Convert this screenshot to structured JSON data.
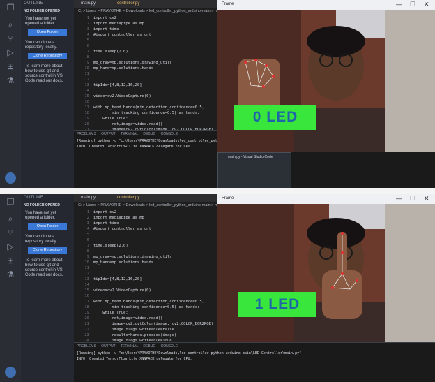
{
  "panels": [
    {
      "sidebar": {
        "header": "OUTLINE",
        "subheader": "NO FOLDER OPENED",
        "msg1": "You have not yet opened a folder.",
        "open_folder": "Open Folder",
        "msg2": "You can clone a repository locally.",
        "clone_repo": "Clone Repository",
        "msg3": "To learn more about how to use git and source control in VS Code read our docs."
      },
      "tabs": [
        "main.py",
        "controller.py"
      ],
      "breadcrumb": "C: > Users > PRAVOTHE > Downloads > led_controller_python_arduino-main > main.py",
      "code": [
        {
          "n": "1",
          "t": "import cv2"
        },
        {
          "n": "2",
          "t": "import mediapipe as mp"
        },
        {
          "n": "3",
          "t": "import time"
        },
        {
          "n": "4",
          "t": "#import controller as cnt"
        },
        {
          "n": "5",
          "t": ""
        },
        {
          "n": "6",
          "t": ""
        },
        {
          "n": "7",
          "t": "time.sleep(2.0)"
        },
        {
          "n": "8",
          "t": ""
        },
        {
          "n": "9",
          "t": "mp_draw=mp.solutions.drawing_utils"
        },
        {
          "n": "10",
          "t": "mp_hand=mp.solutions.hands"
        },
        {
          "n": "11",
          "t": ""
        },
        {
          "n": "12",
          "t": ""
        },
        {
          "n": "13",
          "t": "tipIds=[4,8,12,16,20]"
        },
        {
          "n": "14",
          "t": ""
        },
        {
          "n": "15",
          "t": "video=cv2.VideoCapture(0)"
        },
        {
          "n": "16",
          "t": ""
        },
        {
          "n": "17",
          "t": "with mp_hand.Hands(min_detection_confidence=0.5,"
        },
        {
          "n": "18",
          "t": "        min_tracking_confidence=0.5) as hands:"
        },
        {
          "n": "19",
          "t": "    while True:"
        },
        {
          "n": "20",
          "t": "        ret,image=video.read()"
        },
        {
          "n": "21",
          "t": "        image=cv2.cvtColor(image, cv2.COLOR_BGR2RGB)"
        },
        {
          "n": "22",
          "t": "        image.flags.writeable=False"
        },
        {
          "n": "23",
          "t": "        results=hands.process(image)"
        },
        {
          "n": "24",
          "t": "        image.flags.writeable=True"
        }
      ],
      "terminal": {
        "tabs": "PROBLEMS   OUTPUT   TERMINAL   DEBUG CONSOLE",
        "line1": "[Running] python -u \"c:\\Users\\PRAVOTHE\\Downloads\\led_controller_python_arduino-main\\LED Controller\\main.py\"",
        "line2": "INFO: Created TensorFlow Lite XNNPACK delegate for CPU."
      },
      "camera": {
        "title": "Frame",
        "led_label": "0 LED"
      },
      "taskbar_preview": "main.py - Visual Studio Code"
    },
    {
      "sidebar": {
        "header": "OUTLINE",
        "subheader": "NO FOLDER OPENED",
        "msg1": "You have not yet opened a folder.",
        "open_folder": "Open Folder",
        "msg2": "You can clone a repository locally.",
        "clone_repo": "Clone Repository",
        "msg3": "To learn more about how to use git and source control in VS Code read our docs."
      },
      "tabs": [
        "main.py",
        "controller.py"
      ],
      "breadcrumb": "C: > Users > PRAVOTHE > Downloads > led_controller_python_arduino-main > main.py",
      "code": [
        {
          "n": "1",
          "t": "import cv2"
        },
        {
          "n": "2",
          "t": "import mediapipe as mp"
        },
        {
          "n": "3",
          "t": "import time"
        },
        {
          "n": "4",
          "t": "#import controller as cnt"
        },
        {
          "n": "5",
          "t": ""
        },
        {
          "n": "6",
          "t": ""
        },
        {
          "n": "7",
          "t": "time.sleep(2.0)"
        },
        {
          "n": "8",
          "t": ""
        },
        {
          "n": "9",
          "t": "mp_draw=mp.solutions.drawing_utils"
        },
        {
          "n": "10",
          "t": "mp_hand=mp.solutions.hands"
        },
        {
          "n": "11",
          "t": ""
        },
        {
          "n": "12",
          "t": ""
        },
        {
          "n": "13",
          "t": "tipIds=[4,8,12,16,20]"
        },
        {
          "n": "14",
          "t": ""
        },
        {
          "n": "15",
          "t": "video=cv2.VideoCapture(0)"
        },
        {
          "n": "16",
          "t": ""
        },
        {
          "n": "17",
          "t": "with mp_hand.Hands(min_detection_confidence=0.5,"
        },
        {
          "n": "18",
          "t": "        min_tracking_confidence=0.5) as hands:"
        },
        {
          "n": "19",
          "t": "    while True:"
        },
        {
          "n": "20",
          "t": "        ret,image=video.read()"
        },
        {
          "n": "21",
          "t": "        image=cv2.cvtColor(image, cv2.COLOR_BGR2RGB)"
        },
        {
          "n": "22",
          "t": "        image.flags.writeable=False"
        },
        {
          "n": "23",
          "t": "        results=hands.process(image)"
        },
        {
          "n": "24",
          "t": "        image.flags.writeable=True"
        }
      ],
      "terminal": {
        "tabs": "PROBLEMS   OUTPUT   TERMINAL   DEBUG CONSOLE",
        "line1": "[Running] python -u \"c:\\Users\\PRAVOTHE\\Downloads\\led_controller_python_arduino-main\\LED Controller\\main.py\"",
        "line2": "INFO: Created TensorFlow Lite XNNPACK delegate for CPU."
      },
      "camera": {
        "title": "Frame",
        "led_label": "1 LED"
      },
      "taskbar_preview": ""
    }
  ],
  "colors": {
    "led_bg": "#38e63c",
    "led_text": "#1e66a8",
    "vscode_bg": "#1e1e1e",
    "button": "#3a78d8"
  }
}
